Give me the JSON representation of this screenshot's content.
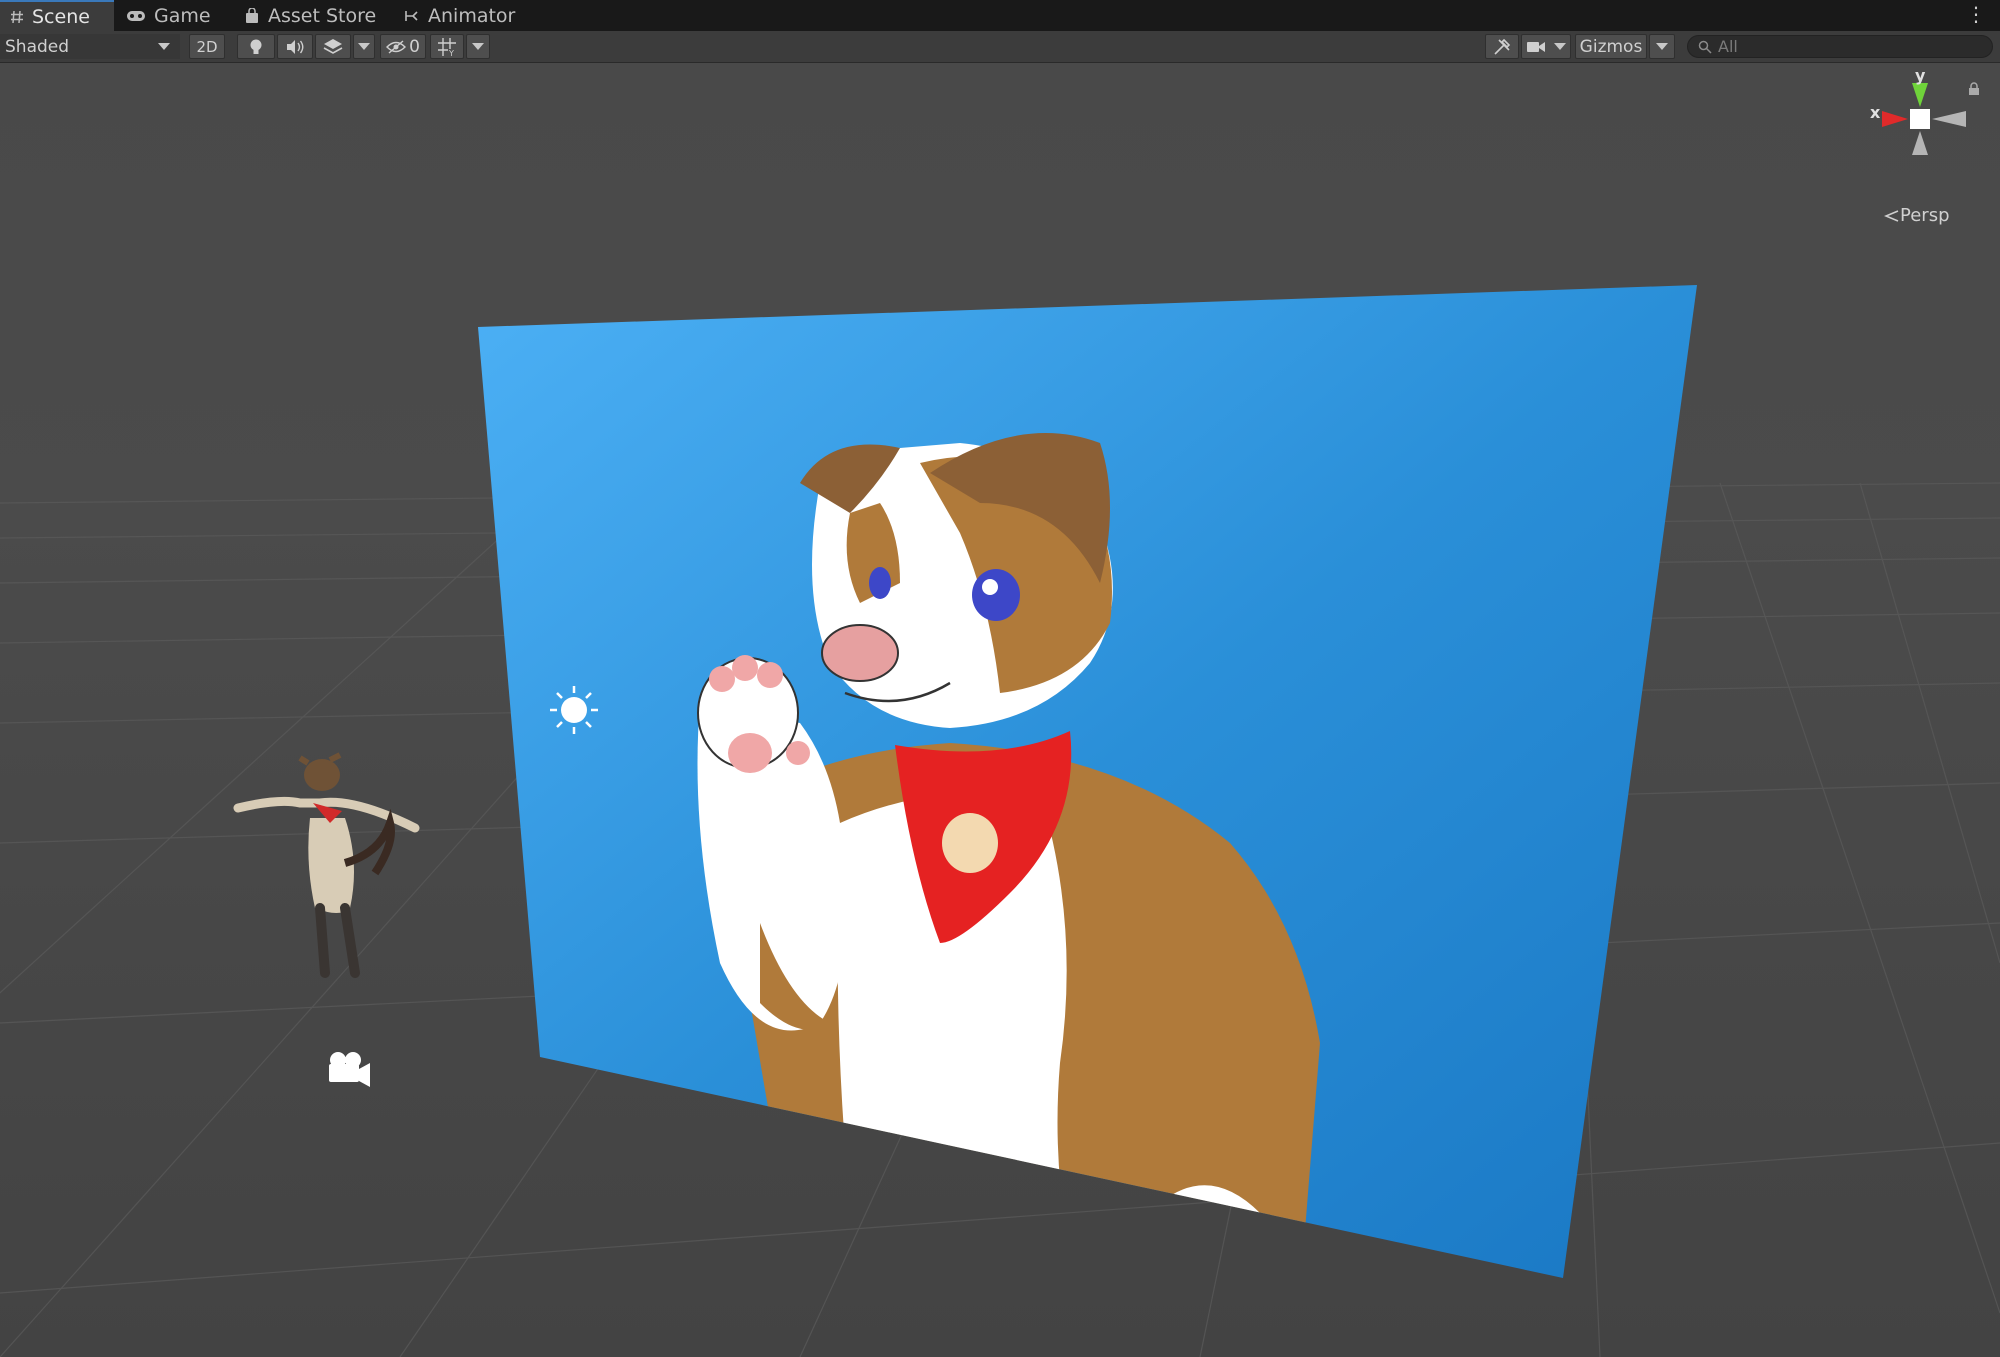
{
  "tabs": [
    {
      "label": "Scene",
      "icon": "hash-icon",
      "active": true
    },
    {
      "label": "Game",
      "icon": "gamepad-icon",
      "active": false
    },
    {
      "label": "Asset Store",
      "icon": "shopping-bag-icon",
      "active": false
    },
    {
      "label": "Animator",
      "icon": "animator-icon",
      "active": false
    }
  ],
  "toolbar": {
    "shading_mode": "Shaded",
    "mode_2d_label": "2D",
    "hidden_count": "0",
    "gizmos_label": "Gizmos",
    "search_placeholder": "All"
  },
  "scene_gizmo": {
    "y_label": "y",
    "x_label": "x",
    "projection_label": "Persp"
  },
  "colors": {
    "tab_accent": "#3a79bb",
    "viewport_bg": "#484848",
    "gizmo_x": "#e02a2a",
    "gizmo_y": "#6fd33a",
    "backdrop_blue": "#2b8fd8"
  },
  "icons": [
    "lightbulb-icon",
    "audio-icon",
    "effects-icon",
    "visibility-icon",
    "grid-icon",
    "tools-icon",
    "camera-icon",
    "lock-icon",
    "sun-light-icon",
    "camera-gizmo-icon",
    "search-icon"
  ]
}
